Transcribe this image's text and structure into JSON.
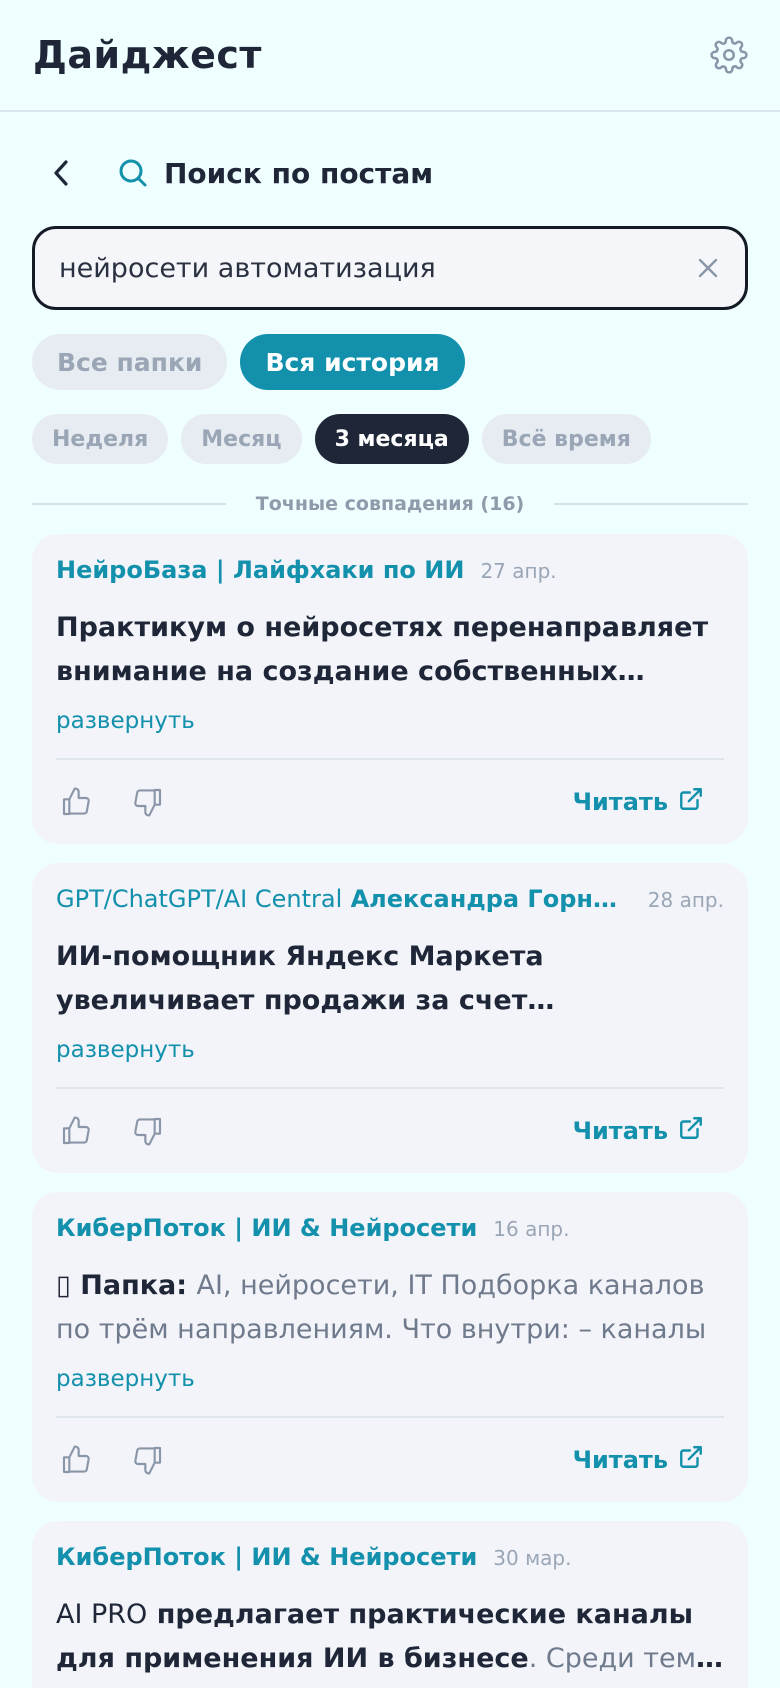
{
  "header": {
    "title": "Дайджест"
  },
  "search": {
    "title": "Поиск по постам",
    "value": "нейросети автоматизация"
  },
  "filters": {
    "scope": [
      {
        "label": "Все папки",
        "active": false
      },
      {
        "label": "Вся история",
        "active": true
      }
    ],
    "period": [
      {
        "label": "Неделя",
        "active": false
      },
      {
        "label": "Месяц",
        "active": false
      },
      {
        "label": "3 месяца",
        "active": true
      },
      {
        "label": "Всё время",
        "active": false
      }
    ]
  },
  "results": {
    "section_label": "Точные совпадения (16)",
    "expand_label": "развернуть",
    "read_label": "Читать",
    "posts": [
      {
        "channel": "НейроБаза | Лайфхаки по ИИ",
        "date": "27 апр.",
        "text": "Практикум о нейросетях перенаправляет внимание на создание собственных решений"
      },
      {
        "channel_light": "GPT/ChatGPT/AI Central",
        "channel": "Александра Горногорская",
        "date": "28 апр.",
        "text": "ИИ-помощник Яндекс Маркета увеличивает продажи за счет персонализации"
      },
      {
        "channel": "КиберПоток | ИИ & Нейросети",
        "date": "16 апр.",
        "icon_glyph": "▯",
        "text_bold": "Папка:",
        "text": "AI, нейросети, IT Подборка каналов по трём направлениям. Что внутри: – каналы"
      },
      {
        "channel": "КиберПоток | ИИ & Нейросети",
        "date": "30 мар.",
        "text_lead": "AI PRO",
        "text_bold": "предлагает практические каналы для применения ИИ в бизнесе",
        "text": ". Среди тем — автоматизация"
      }
    ]
  },
  "colors": {
    "background": "#effefe",
    "accent": "#1290ac",
    "dark": "#1e2637",
    "card": "#f2f4f9"
  }
}
